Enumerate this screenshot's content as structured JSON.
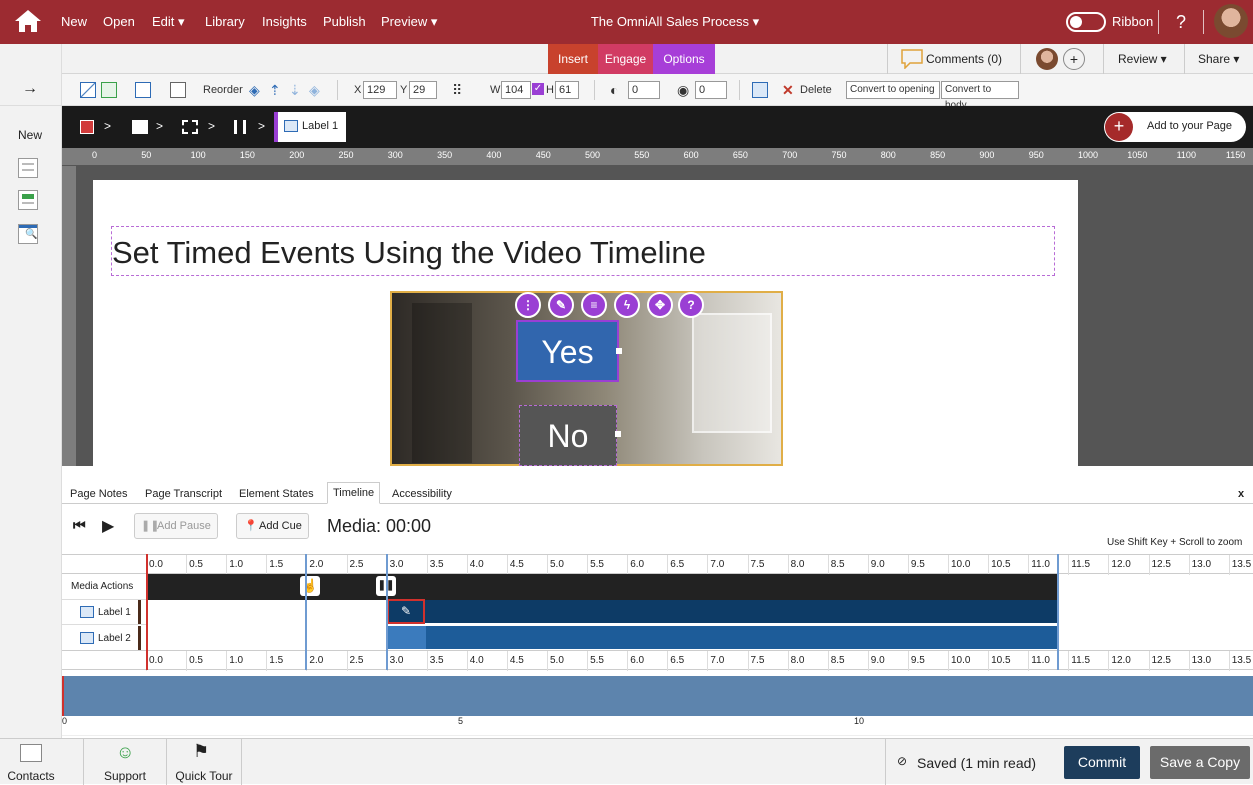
{
  "topbar": {
    "menu": [
      "New",
      "Open",
      "Edit ▾",
      "Library",
      "Insights",
      "Publish",
      "Preview ▾"
    ],
    "doc_title": "The OmniAll Sales Process ▾",
    "ribbon_label": "Ribbon",
    "help": "?"
  },
  "row2": {
    "tabs": [
      "Insert",
      "Engage",
      "Options"
    ],
    "comments": "Comments (0)",
    "review": "Review ▾",
    "share": "Share ▾"
  },
  "toolbar": {
    "reorder": "Reorder",
    "x_label": "X",
    "x_value": "129",
    "y_label": "Y",
    "y_value": "29",
    "w_label": "W",
    "w_value": "104",
    "h_label": "H",
    "h_value": "61",
    "opacity_value": "0",
    "rotate_value": "0",
    "delete": "Delete",
    "convert_opening": "Convert to opening",
    "convert_body": "Convert to body"
  },
  "leftrail": {
    "new_label": "New"
  },
  "breadcrumb": {
    "current": "Label 1",
    "add_page": "Add to your Page"
  },
  "ruler_labels": [
    "0",
    "50",
    "100",
    "150",
    "200",
    "250",
    "300",
    "350",
    "400",
    "450",
    "500",
    "550",
    "600",
    "650",
    "700",
    "750",
    "800",
    "850",
    "900",
    "950",
    "1000",
    "1050",
    "1100",
    "1150"
  ],
  "page": {
    "heading": "Set Timed Events Using the Video Timeline",
    "yes": "Yes",
    "no": "No"
  },
  "panel": {
    "tabs": [
      "Page Notes",
      "Page Transcript",
      "Element States",
      "Timeline",
      "Accessibility"
    ],
    "active_tab": "Timeline",
    "close": "x"
  },
  "timeline": {
    "add_pause": "Add Pause",
    "add_cue": "Add Cue",
    "media_time": "Media: 00:00",
    "zoom_hint": "Use Shift Key + Scroll to zoom",
    "ticks": [
      "0.0",
      "0.5",
      "1.0",
      "1.5",
      "2.0",
      "2.5",
      "3.0",
      "3.5",
      "4.0",
      "4.5",
      "5.0",
      "5.5",
      "6.0",
      "6.5",
      "7.0",
      "7.5",
      "8.0",
      "8.5",
      "9.0",
      "9.5",
      "10.0",
      "10.5",
      "11.0",
      "11.5",
      "12.0",
      "12.5",
      "13.0",
      "13.5"
    ],
    "rows": [
      "Media Actions",
      "Label 1",
      "Label 2"
    ],
    "scrub_labels": [
      "0",
      "5",
      "10"
    ]
  },
  "footer": {
    "contacts": "Contacts",
    "support": "Support",
    "quick_tour": "Quick Tour",
    "saved": "Saved (1 min read)",
    "commit": "Commit",
    "save_copy": "Save a Copy"
  }
}
